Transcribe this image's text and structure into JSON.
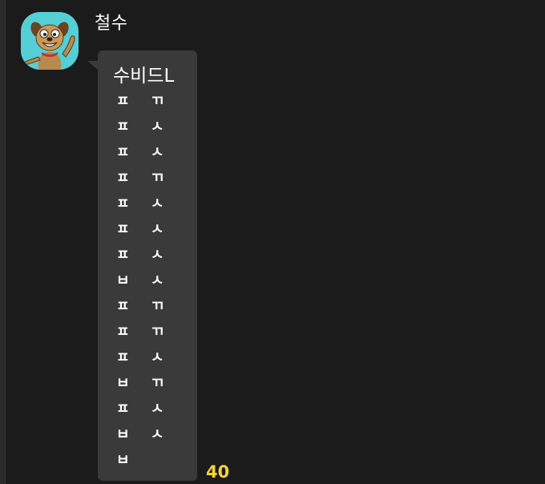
{
  "chat": {
    "sender_name": "철수",
    "avatar_icon": "cartoon-dog-avatar-icon",
    "avatar_bg": "#55cfd6",
    "bubble_bg": "#3a3a3a",
    "message": {
      "title": "수비드L",
      "lines": [
        "ㅍ ㄲ",
        "ㅍ ㅅ",
        "ㅍ ㅅ",
        "ㅍ ㄲ",
        "ㅍ ㅅ",
        "ㅍ ㅅ",
        "ㅍ ㅅ",
        "ㅂ ㅅ",
        "ㅍ ㄲ",
        "ㅍ ㄲ",
        "ㅍ ㅅ",
        "ㅂ ㄲ",
        "ㅍ ㅅ",
        "ㅂ ㅅ",
        "ㅂ"
      ]
    },
    "unread_count": "40",
    "unread_color": "#f5d43c"
  }
}
